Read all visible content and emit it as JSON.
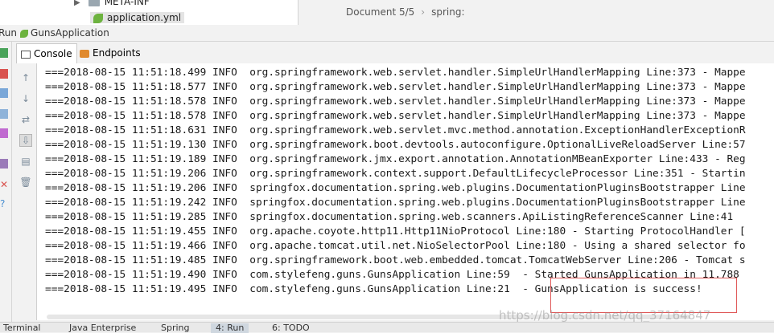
{
  "project_tree": {
    "meta_inf": "META-INF",
    "application_yml": "application.yml"
  },
  "editor": {
    "document_position": "Document 5/5",
    "breadcrumb": "spring:"
  },
  "run_panel": {
    "title_prefix": "Run",
    "app_name": "GunsApplication",
    "tabs": [
      {
        "label": "Console"
      },
      {
        "label": "Endpoints"
      }
    ]
  },
  "log_lines": [
    "===2018-08-15 11:51:18.499 INFO  org.springframework.web.servlet.handler.SimpleUrlHandlerMapping Line:373 - Mappe",
    "===2018-08-15 11:51:18.577 INFO  org.springframework.web.servlet.handler.SimpleUrlHandlerMapping Line:373 - Mappe",
    "===2018-08-15 11:51:18.578 INFO  org.springframework.web.servlet.handler.SimpleUrlHandlerMapping Line:373 - Mappe",
    "===2018-08-15 11:51:18.578 INFO  org.springframework.web.servlet.handler.SimpleUrlHandlerMapping Line:373 - Mappe",
    "===2018-08-15 11:51:18.631 INFO  org.springframework.web.servlet.mvc.method.annotation.ExceptionHandlerExceptionR",
    "===2018-08-15 11:51:19.130 INFO  org.springframework.boot.devtools.autoconfigure.OptionalLiveReloadServer Line:57",
    "===2018-08-15 11:51:19.189 INFO  org.springframework.jmx.export.annotation.AnnotationMBeanExporter Line:433 - Reg",
    "===2018-08-15 11:51:19.206 INFO  org.springframework.context.support.DefaultLifecycleProcessor Line:351 - Startin",
    "===2018-08-15 11:51:19.206 INFO  springfox.documentation.spring.web.plugins.DocumentationPluginsBootstrapper Line",
    "===2018-08-15 11:51:19.242 INFO  springfox.documentation.spring.web.plugins.DocumentationPluginsBootstrapper Line",
    "===2018-08-15 11:51:19.285 INFO  springfox.documentation.spring.web.scanners.ApiListingReferenceScanner Line:41",
    "===2018-08-15 11:51:19.455 INFO  org.apache.coyote.http11.Http11NioProtocol Line:180 - Starting ProtocolHandler [",
    "===2018-08-15 11:51:19.466 INFO  org.apache.tomcat.util.net.NioSelectorPool Line:180 - Using a shared selector fo",
    "===2018-08-15 11:51:19.485 INFO  org.springframework.boot.web.embedded.tomcat.TomcatWebServer Line:206 - Tomcat s",
    "===2018-08-15 11:51:19.490 INFO  com.stylefeng.guns.GunsApplication Line:59  - Started GunsApplication in 11.788",
    "===2018-08-15 11:51:19.495 INFO  com.stylefeng.guns.GunsApplication Line:21  - GunsApplication is success!"
  ],
  "watermark": "https://blog.csdn.net/qq_37164847",
  "bottom_tabs": [
    {
      "label": "Terminal"
    },
    {
      "label": "Java Enterprise"
    },
    {
      "label": "Spring"
    },
    {
      "label": "4: Run"
    },
    {
      "label": "6: TODO"
    }
  ],
  "colors": {
    "highlight_border": "#e05a5a",
    "spring_green": "#6db33f",
    "endpoints_orange": "#e08a2f"
  }
}
